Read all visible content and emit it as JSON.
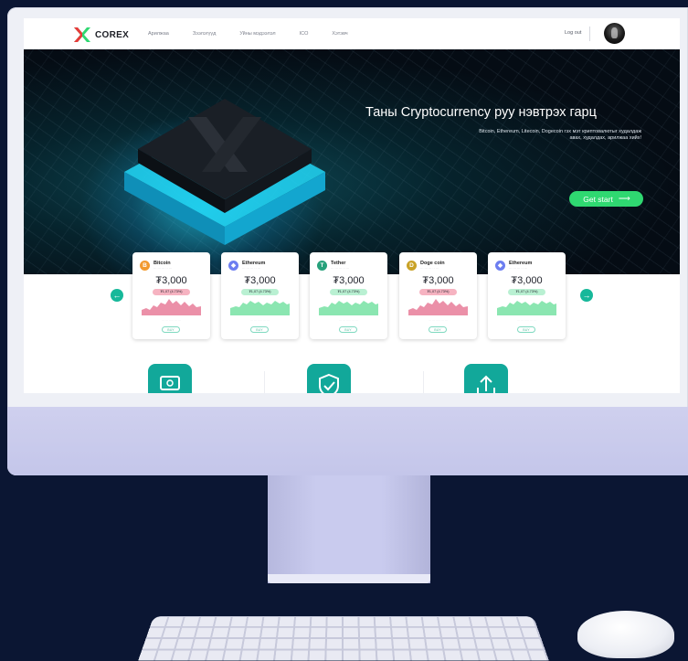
{
  "nav": {
    "brand": "COREX",
    "items": [
      "Арилжаа",
      "Зээлэгүүд",
      "Уйны мэдээлэл",
      "ICO",
      "Хэтэвч"
    ],
    "logout": "Log out"
  },
  "hero": {
    "title": "Таны Cryptocurrency руу нэвтрэх гарц",
    "description": "Bitcoin, Ethereum, Litecoin, Dogecoin гэх мэт криптовалютыг худалдаж авах, худалдах, арилжаа хийх!",
    "cta": "Get start",
    "cta_arrow": "⟶"
  },
  "cards": [
    {
      "name": "Bitcoin",
      "subtitle": "··· ··· ··· ·· ···",
      "price": "₮3,000",
      "change": "₮1,07 (4.73%)",
      "trend": "down",
      "color": "#f29a2e",
      "icon": "bitcoin-icon",
      "glyph": "B",
      "footer": "··· ··· ··· ·· ··· ···",
      "buy": "BUY"
    },
    {
      "name": "Ethereum",
      "subtitle": "··· ··· ··· ·· ···",
      "price": "₮3,000",
      "change": "₮1,07 (4.73%)",
      "trend": "up",
      "color": "#6d7ef0",
      "icon": "ethereum-icon",
      "glyph": "◆",
      "footer": "··· ··· ··· ·· ··· ···",
      "buy": "BUY"
    },
    {
      "name": "Tether",
      "subtitle": "··· ··· ··· ·· ···",
      "price": "₮3,000",
      "change": "₮1,07 (4.73%)",
      "trend": "up",
      "color": "#26a17b",
      "icon": "tether-icon",
      "glyph": "T",
      "footer": "··· ··· ··· ·· ··· ···",
      "buy": "BUY"
    },
    {
      "name": "Doge coin",
      "subtitle": "··· ··· ··· ·· ···",
      "price": "₮3,000",
      "change": "₮1,07 (4.73%)",
      "trend": "down",
      "color": "#c9a227",
      "icon": "dogecoin-icon",
      "glyph": "D",
      "footer": "··· ··· ··· ·· ··· ···",
      "buy": "BUY"
    },
    {
      "name": "Ethereum",
      "subtitle": "··· ··· ··· ·· ···",
      "price": "₮3,000",
      "change": "₮1,07 (4.73%)",
      "trend": "up",
      "color": "#6d7ef0",
      "icon": "ethereum-icon",
      "glyph": "◆",
      "footer": "··· ··· ··· ·· ··· ···",
      "buy": "BUY"
    }
  ],
  "carousel": {
    "prev": "←",
    "next": "→"
  },
  "features": [
    {
      "icon": "money-icon"
    },
    {
      "icon": "shield-check-icon"
    },
    {
      "icon": "upload-icon"
    }
  ],
  "colors": {
    "accent_green": "#2fd871",
    "teal": "#17b89a",
    "down_pill": "#f6b3c1",
    "up_pill": "#b9f0d2",
    "down_chart": "#e9849e",
    "up_chart": "#7ee3a8"
  }
}
